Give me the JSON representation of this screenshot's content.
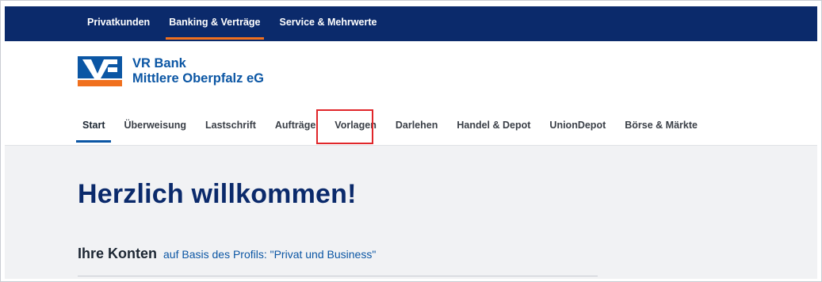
{
  "topnav": {
    "items": [
      {
        "label": "Privatkunden",
        "active": false
      },
      {
        "label": "Banking & Verträge",
        "active": true
      },
      {
        "label": "Service & Mehrwerte",
        "active": false
      }
    ]
  },
  "brand": {
    "line1": "VR Bank",
    "line2": "Mittlere Oberpfalz eG",
    "logo_icon": "volksbank-logo-icon"
  },
  "mainnav": {
    "items": [
      {
        "label": "Start",
        "active": true
      },
      {
        "label": "Überweisung",
        "active": false
      },
      {
        "label": "Lastschrift",
        "active": false
      },
      {
        "label": "Aufträge",
        "active": false
      },
      {
        "label": "Vorlagen",
        "active": false,
        "highlighted": true
      },
      {
        "label": "Darlehen",
        "active": false
      },
      {
        "label": "Handel & Depot",
        "active": false
      },
      {
        "label": "UnionDepot",
        "active": false
      },
      {
        "label": "Börse & Märkte",
        "active": false
      }
    ]
  },
  "main": {
    "welcome": "Herzlich willkommen!",
    "accounts_title": "Ihre Konten",
    "accounts_subtitle": "auf Basis des Profils: \"Privat und Business\""
  },
  "colors": {
    "topbar": "#0b2a6b",
    "accent_orange": "#f0701e",
    "brand_blue": "#0b56a4",
    "highlight_red": "#e0262a",
    "content_bg": "#f1f2f4"
  }
}
